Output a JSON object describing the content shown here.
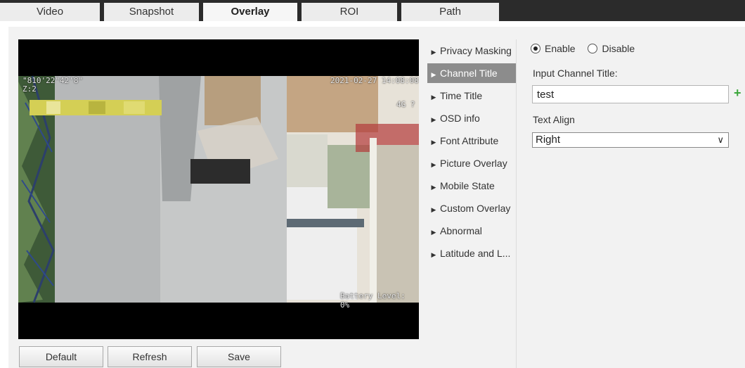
{
  "tabs": [
    {
      "label": "Video"
    },
    {
      "label": "Snapshot"
    },
    {
      "label": "Overlay"
    },
    {
      "label": "ROI"
    },
    {
      "label": "Path"
    }
  ],
  "active_tab": "Overlay",
  "video": {
    "osd_coords": "\"810'22\"42'8\"",
    "osd_zone": "Z:2",
    "osd_datetime": "2021-02-27 14:08:08",
    "osd_signal": "4G ?",
    "osd_battery": "Battery Level: 0%"
  },
  "buttons": {
    "default": "Default",
    "refresh": "Refresh",
    "save": "Save"
  },
  "menu": {
    "items": [
      {
        "label": "Privacy Masking"
      },
      {
        "label": "Channel Title"
      },
      {
        "label": "Time Title"
      },
      {
        "label": "OSD info"
      },
      {
        "label": "Font Attribute"
      },
      {
        "label": "Picture Overlay"
      },
      {
        "label": "Mobile State"
      },
      {
        "label": "Custom Overlay"
      },
      {
        "label": "Abnormal"
      },
      {
        "label": "Latitude and L..."
      }
    ],
    "active": "Channel Title"
  },
  "panel": {
    "enable_label": "Enable",
    "disable_label": "Disable",
    "enabled": true,
    "input_title_label": "Input Channel Title:",
    "channel_title_value": "test",
    "add_icon": "plus-icon",
    "text_align_label": "Text Align",
    "text_align_value": "Right"
  },
  "colors": {
    "active_menu_bg": "#8c8c8c",
    "tabbar_bg": "#2b2b2b",
    "plus_green": "#3aa63a"
  }
}
